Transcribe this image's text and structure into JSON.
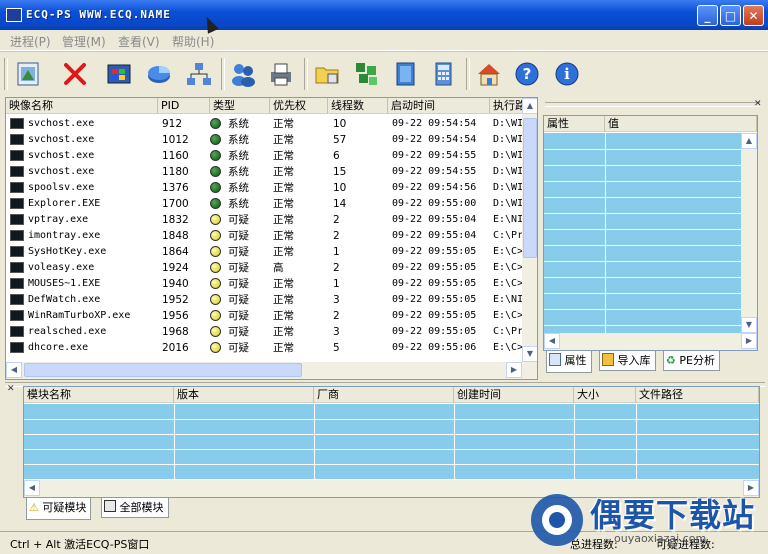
{
  "window": {
    "title": "ECQ-PS  WWW.ECQ.NAME",
    "minimize": "_",
    "maximize": "□",
    "close": "✕"
  },
  "menu": [
    "进程(P)",
    "管理(M)",
    "查看(V)",
    "帮助(H)"
  ],
  "toolbar": [
    "new-process-icon",
    "kill-process-icon",
    "windows-icon",
    "pie-chart-icon",
    "network-icon",
    "users-icon",
    "printer-icon",
    "folder-icon",
    "modules-icon",
    "notebook-icon",
    "calculator-icon",
    "home-icon",
    "help-icon",
    "info-icon"
  ],
  "process_table": {
    "columns": [
      "映像名称",
      "PID",
      "类型",
      "优先权",
      "线程数",
      "启动时间",
      "执行路"
    ],
    "rows": [
      {
        "name": "svchost.exe",
        "pid": "912",
        "type": "系统",
        "status": "system",
        "priority": "正常",
        "threads": "10",
        "start": "09-22 09:54:54",
        "path": "D:\\WI"
      },
      {
        "name": "svchost.exe",
        "pid": "1012",
        "type": "系统",
        "status": "system",
        "priority": "正常",
        "threads": "57",
        "start": "09-22 09:54:54",
        "path": "D:\\WI"
      },
      {
        "name": "svchost.exe",
        "pid": "1160",
        "type": "系统",
        "status": "system",
        "priority": "正常",
        "threads": "6",
        "start": "09-22 09:54:55",
        "path": "D:\\WI"
      },
      {
        "name": "svchost.exe",
        "pid": "1180",
        "type": "系统",
        "status": "system",
        "priority": "正常",
        "threads": "15",
        "start": "09-22 09:54:55",
        "path": "D:\\WI"
      },
      {
        "name": "spoolsv.exe",
        "pid": "1376",
        "type": "系统",
        "status": "system",
        "priority": "正常",
        "threads": "10",
        "start": "09-22 09:54:56",
        "path": "D:\\WI"
      },
      {
        "name": "Explorer.EXE",
        "pid": "1700",
        "type": "系统",
        "status": "system",
        "priority": "正常",
        "threads": "14",
        "start": "09-22 09:55:00",
        "path": "D:\\WI"
      },
      {
        "name": "vptray.exe",
        "pid": "1832",
        "type": "可疑",
        "status": "suspect",
        "priority": "正常",
        "threads": "2",
        "start": "09-22 09:55:04",
        "path": "E:\\NI"
      },
      {
        "name": "imontray.exe",
        "pid": "1848",
        "type": "可疑",
        "status": "suspect",
        "priority": "正常",
        "threads": "2",
        "start": "09-22 09:55:04",
        "path": "C:\\Pr"
      },
      {
        "name": "SysHotKey.exe",
        "pid": "1864",
        "type": "可疑",
        "status": "suspect",
        "priority": "正常",
        "threads": "1",
        "start": "09-22 09:55:05",
        "path": "E:\\C>"
      },
      {
        "name": "voleasy.exe",
        "pid": "1924",
        "type": "可疑",
        "status": "suspect",
        "priority": "高",
        "threads": "2",
        "start": "09-22 09:55:05",
        "path": "E:\\C>"
      },
      {
        "name": "MOUSES~1.EXE",
        "pid": "1940",
        "type": "可疑",
        "status": "suspect",
        "priority": "正常",
        "threads": "1",
        "start": "09-22 09:55:05",
        "path": "E:\\C>"
      },
      {
        "name": "DefWatch.exe",
        "pid": "1952",
        "type": "可疑",
        "status": "suspect",
        "priority": "正常",
        "threads": "3",
        "start": "09-22 09:55:05",
        "path": "E:\\NI"
      },
      {
        "name": "WinRamTurboXP.exe",
        "pid": "1956",
        "type": "可疑",
        "status": "suspect",
        "priority": "正常",
        "threads": "2",
        "start": "09-22 09:55:05",
        "path": "E:\\C>"
      },
      {
        "name": "realsched.exe",
        "pid": "1968",
        "type": "可疑",
        "status": "suspect",
        "priority": "正常",
        "threads": "3",
        "start": "09-22 09:55:05",
        "path": "C:\\Pr"
      },
      {
        "name": "dhcore.exe",
        "pid": "2016",
        "type": "可疑",
        "status": "suspect",
        "priority": "正常",
        "threads": "5",
        "start": "09-22 09:55:06",
        "path": "E:\\C>"
      }
    ]
  },
  "props_panel": {
    "columns": [
      "属性",
      "值"
    ]
  },
  "props_tabs": [
    "属性",
    "导入库",
    "PE分析"
  ],
  "module_table": {
    "columns": [
      "模块名称",
      "版本",
      "厂商",
      "创建时间",
      "大小",
      "文件路径"
    ]
  },
  "module_tabs": [
    "可疑模块",
    "全部模块"
  ],
  "status": {
    "hint": "Ctrl + Alt 激活ECQ-PS窗口",
    "total": "总进程数:",
    "suspect": "可疑进程数:"
  },
  "watermark": {
    "cn": "偶要下载站",
    "url": "ouyaoxiazai.com"
  },
  "colors": {
    "system_dot": "#0d5a12",
    "suspect_dot": "#d8c815",
    "grid_blue": "#87cdeb",
    "title_blue": "#0a4fd6"
  }
}
